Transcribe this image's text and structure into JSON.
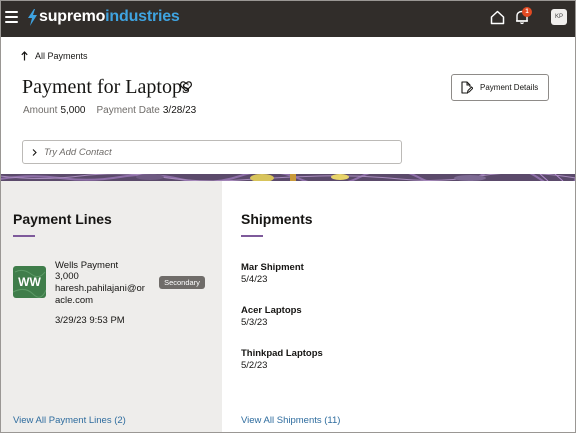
{
  "header": {
    "brand_part1": "supremo",
    "brand_part2": "industries",
    "notification_count": "1",
    "user_initials": "KP"
  },
  "nav": {
    "back_label": "All Payments"
  },
  "page": {
    "title": "Payment for Laptops",
    "amount_label": "Amount",
    "amount_value": "5,000",
    "payment_date_label": "Payment Date",
    "payment_date_value": "3/28/23",
    "details_button_label": "Payment Details",
    "contact_placeholder": "Try Add Contact"
  },
  "payment_lines": {
    "title": "Payment Lines",
    "item": {
      "initials": "WW",
      "name": "Wells Payment",
      "amount": "3,000",
      "email_line1": "haresh.pahilajani@or",
      "email_line2": "acle.com",
      "datetime": "3/29/23 9:53 PM",
      "badge": "Secondary"
    },
    "view_all": "View All Payment Lines (2)"
  },
  "shipments": {
    "title": "Shipments",
    "items": [
      {
        "name": "Mar Shipment",
        "date": "5/4/23"
      },
      {
        "name": "Acer Laptops",
        "date": "5/3/23"
      },
      {
        "name": "Thinkpad Laptops",
        "date": "5/2/23"
      }
    ],
    "view_all": "View All Shipments (11)"
  },
  "colors": {
    "header_bg": "#312d2a",
    "brand_accent": "#3fa3e0",
    "section_accent": "#7e5a9b",
    "link": "#2e6c9e",
    "avatar_bg": "#3f7d4a",
    "badge_bg": "#6f6c69",
    "notification_badge": "#e24a23"
  },
  "icons": {
    "menu": "hamburger-icon",
    "brand": "lightning-bolt-icon",
    "home": "home-icon",
    "notifications": "bell-icon",
    "back": "arrow-up-icon",
    "favorite": "heart-icon",
    "details": "document-edit-icon",
    "contact": "chevron-right-icon"
  }
}
